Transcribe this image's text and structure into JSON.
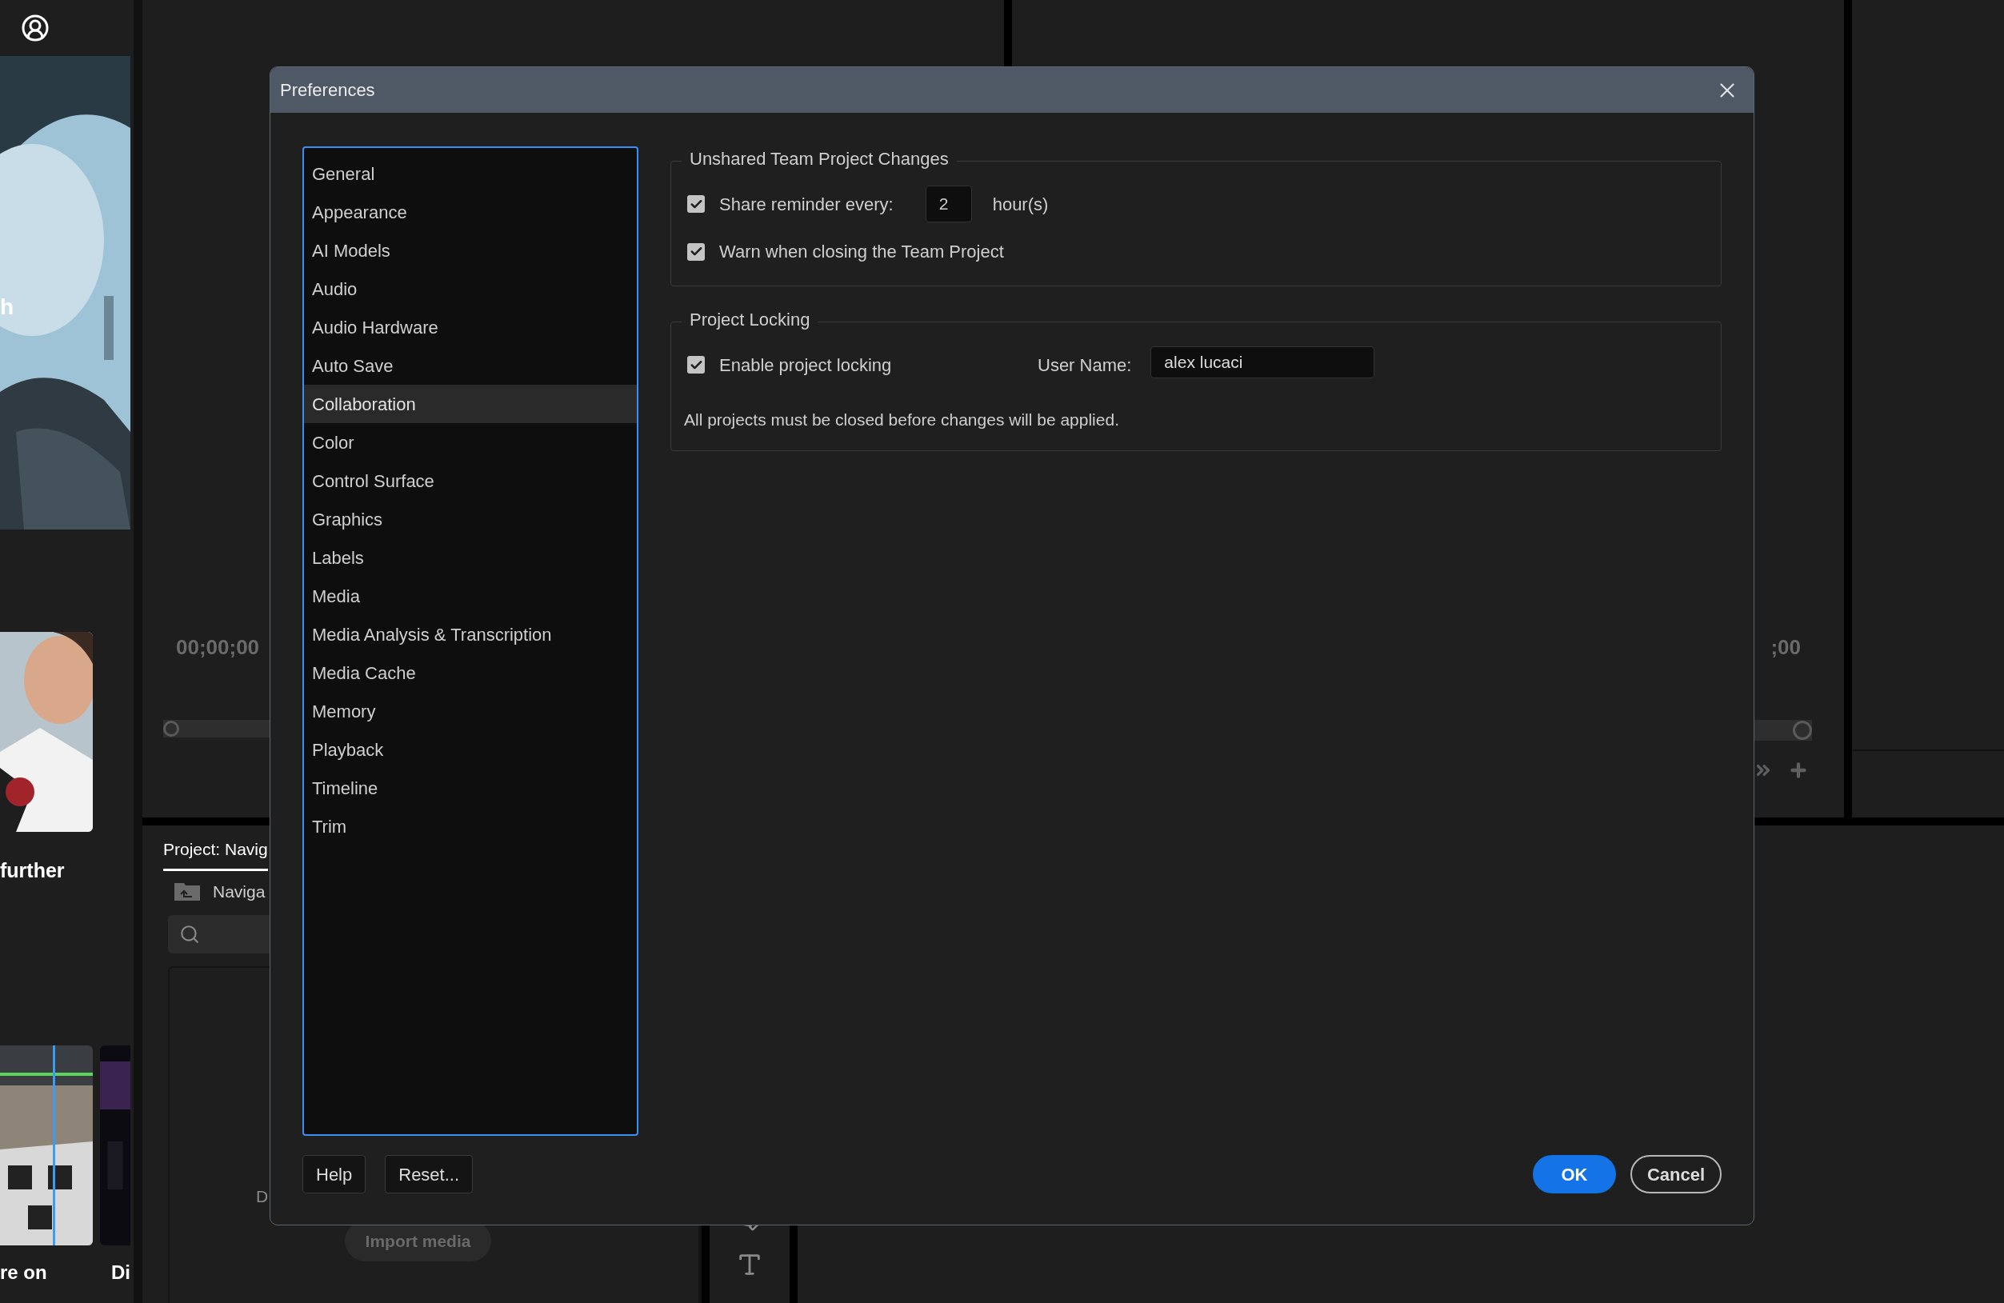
{
  "feed": {
    "headline_fragment": "h",
    "caption_1": "further",
    "caption_2": "re on",
    "caption_3": "Di"
  },
  "source_monitor": {
    "timecode": "00;00;00"
  },
  "program_monitor": {
    "timecode": ";00"
  },
  "project_panel": {
    "tab": "Project: Navig",
    "folder": "Naviga",
    "bin_text": "D",
    "import_button": "Import media"
  },
  "dialog": {
    "title": "Preferences",
    "categories": [
      {
        "label": "General",
        "selected": false
      },
      {
        "label": "Appearance",
        "selected": false
      },
      {
        "label": "AI Models",
        "selected": false
      },
      {
        "label": "Audio",
        "selected": false
      },
      {
        "label": "Audio Hardware",
        "selected": false
      },
      {
        "label": "Auto Save",
        "selected": false
      },
      {
        "label": "Collaboration",
        "selected": true
      },
      {
        "label": "Color",
        "selected": false
      },
      {
        "label": "Control Surface",
        "selected": false
      },
      {
        "label": "Graphics",
        "selected": false
      },
      {
        "label": "Labels",
        "selected": false
      },
      {
        "label": "Media",
        "selected": false
      },
      {
        "label": "Media Analysis & Transcription",
        "selected": false
      },
      {
        "label": "Media Cache",
        "selected": false
      },
      {
        "label": "Memory",
        "selected": false
      },
      {
        "label": "Playback",
        "selected": false
      },
      {
        "label": "Timeline",
        "selected": false
      },
      {
        "label": "Trim",
        "selected": false
      }
    ],
    "unshared_changes": {
      "title": "Unshared Team Project Changes",
      "share_reminder": {
        "label": "Share reminder every:",
        "checked": true,
        "value": "2",
        "unit": "hour(s)"
      },
      "warn_closing": {
        "label": "Warn when closing the Team Project",
        "checked": true
      }
    },
    "project_locking": {
      "title": "Project Locking",
      "enable_locking": {
        "label": "Enable project locking",
        "checked": true
      },
      "user_name": {
        "label": "User Name:",
        "value": "alex lucaci"
      },
      "note": "All projects must be closed before changes will be applied."
    },
    "buttons_left": [
      "Help",
      "Reset..."
    ],
    "buttons_right": [
      {
        "label": "OK",
        "kind": "primary"
      },
      {
        "label": "Cancel",
        "kind": "secondary"
      }
    ]
  }
}
